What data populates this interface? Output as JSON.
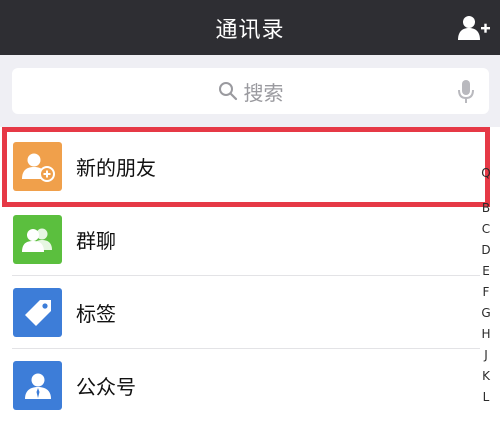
{
  "header": {
    "title": "通讯录"
  },
  "search": {
    "placeholder": "搜索"
  },
  "list": [
    {
      "label": "新的朋友",
      "color": "#f0a04b",
      "icon": "person-add-icon"
    },
    {
      "label": "群聊",
      "color": "#5bbf3e",
      "icon": "group-icon"
    },
    {
      "label": "标签",
      "color": "#3d7dd8",
      "icon": "tag-icon"
    },
    {
      "label": "公众号",
      "color": "#3d7dd8",
      "icon": "official-account-icon"
    }
  ],
  "index": [
    "Q",
    "B",
    "C",
    "D",
    "E",
    "F",
    "G",
    "H",
    "J",
    "K",
    "L"
  ],
  "colors": {
    "header_bg": "#2e2e33",
    "highlight": "#e63946"
  }
}
